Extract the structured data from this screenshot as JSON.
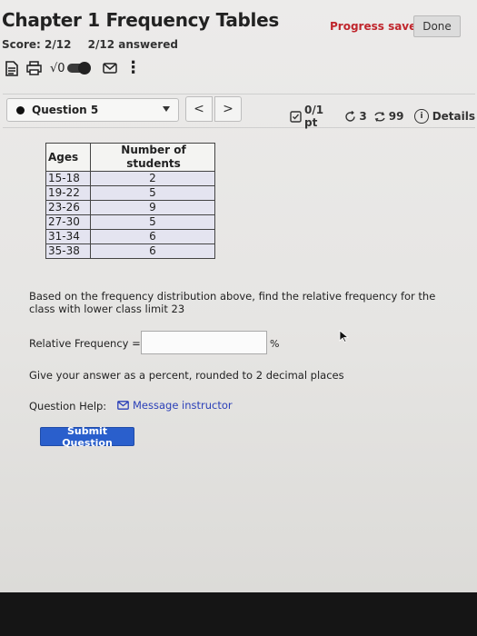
{
  "header": {
    "title": "Chapter 1 Frequency Tables",
    "progress_status": "Progress saved",
    "done_label": "Done",
    "score": "Score: 2/12",
    "answered": "2/12 answered",
    "sqrt_label": "√0"
  },
  "question_bar": {
    "question_label": "Question 5",
    "prev_label": "<",
    "next_label": ">",
    "points": "0/1 pt",
    "attempts": "3",
    "retries": "99",
    "details_label": "Details"
  },
  "table": {
    "headers": [
      "Ages",
      "Number of students"
    ],
    "rows": [
      {
        "age": "15-18",
        "count": "2"
      },
      {
        "age": "19-22",
        "count": "5"
      },
      {
        "age": "23-26",
        "count": "9"
      },
      {
        "age": "27-30",
        "count": "5"
      },
      {
        "age": "31-34",
        "count": "6"
      },
      {
        "age": "35-38",
        "count": "6"
      }
    ]
  },
  "question": {
    "prompt": "Based on the frequency distribution above, find the relative frequency for the class with lower class limit 23",
    "relative_label": "Relative Frequency =",
    "relative_value": "",
    "percent_sign": "%",
    "instructions": "Give your answer as a percent, rounded to 2 decimal places",
    "help_label": "Question Help:",
    "message_link": "Message instructor",
    "submit_label": "Submit Question"
  },
  "colors": {
    "accent_red": "#c0262d",
    "submit_blue": "#2a5fcc",
    "link_blue": "#2a3fb8",
    "table_cell": "#e4e4f0"
  }
}
